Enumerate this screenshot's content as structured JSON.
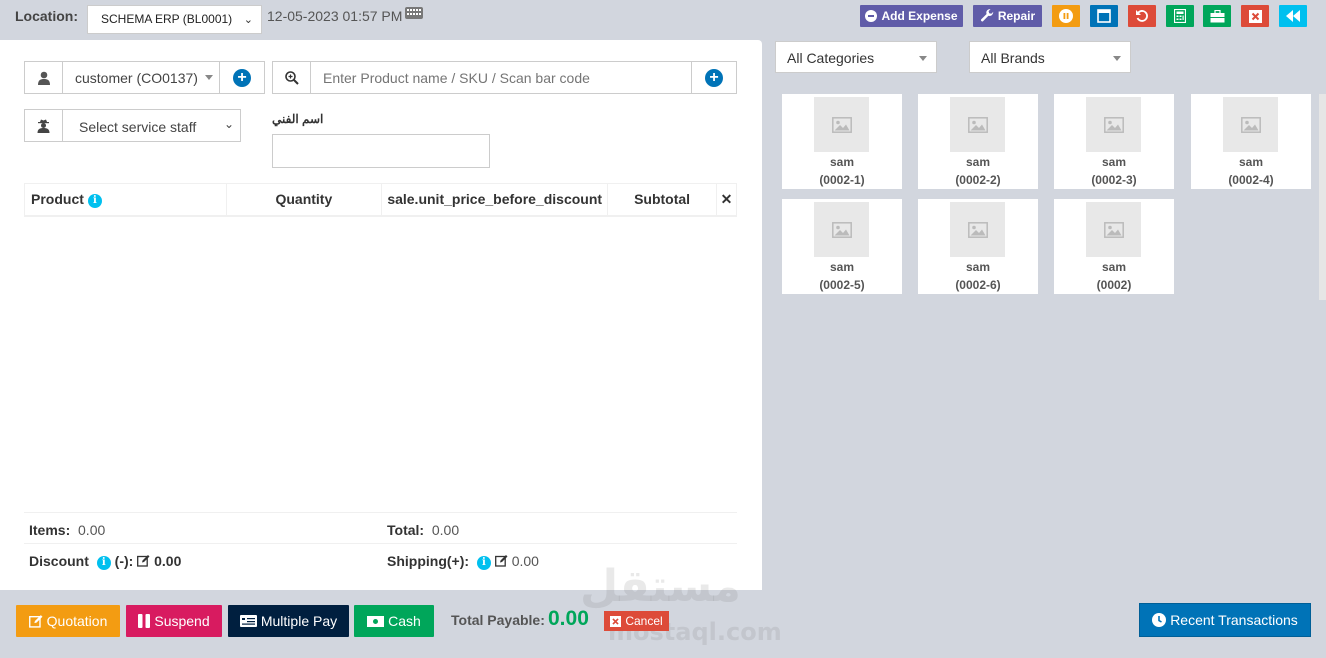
{
  "header": {
    "location_label": "Location:",
    "location_value": "SCHEMA ERP (BL0001)",
    "datetime": "12-05-2023 01:57 PM",
    "buttons": {
      "add_expense": "Add Expense",
      "repair": "Repair"
    }
  },
  "form": {
    "customer_value": "customer (CO0137)",
    "search_placeholder": "Enter Product name / SKU / Scan bar code",
    "service_staff_value": "Select service staff",
    "technician_label": "اسم الفني",
    "technician_value": ""
  },
  "table": {
    "headers": {
      "product": "Product",
      "quantity": "Quantity",
      "unit_price": "sale.unit_price_before_discount",
      "subtotal": "Subtotal",
      "remove": "✕"
    },
    "rows": []
  },
  "totals": {
    "items_label": "Items:",
    "items_value": "0.00",
    "total_label": "Total:",
    "total_value": "0.00",
    "discount_label": "Discount",
    "discount_suffix": "(-):",
    "discount_value": "0.00",
    "shipping_label": "Shipping(+):",
    "shipping_value": "0.00"
  },
  "footer": {
    "quotation": "Quotation",
    "suspend": "Suspend",
    "multiple_pay": "Multiple Pay",
    "cash": "Cash",
    "total_payable_label": "Total Payable:",
    "total_payable_value": "0.00",
    "cancel": "Cancel",
    "recent_transactions": "Recent Transactions"
  },
  "filters": {
    "categories": "All Categories",
    "brands": "All Brands"
  },
  "products": [
    {
      "name": "sam",
      "sku": "(0002-1)"
    },
    {
      "name": "sam",
      "sku": "(0002-2)"
    },
    {
      "name": "sam",
      "sku": "(0002-3)"
    },
    {
      "name": "sam",
      "sku": "(0002-4)"
    },
    {
      "name": "sam",
      "sku": "(0002-5)"
    },
    {
      "name": "sam",
      "sku": "(0002-6)"
    },
    {
      "name": "sam",
      "sku": "(0002)"
    }
  ],
  "watermark": {
    "text": "مستقل",
    "domain": "mostaql.com"
  },
  "colors": {
    "purple": "#605ca8",
    "orange": "#f39c12",
    "blue": "#0073b7",
    "red": "#dd4b39",
    "green": "#00a65a",
    "cyan": "#00c0ef",
    "pink": "#d81b60",
    "navy": "#001f3f"
  }
}
